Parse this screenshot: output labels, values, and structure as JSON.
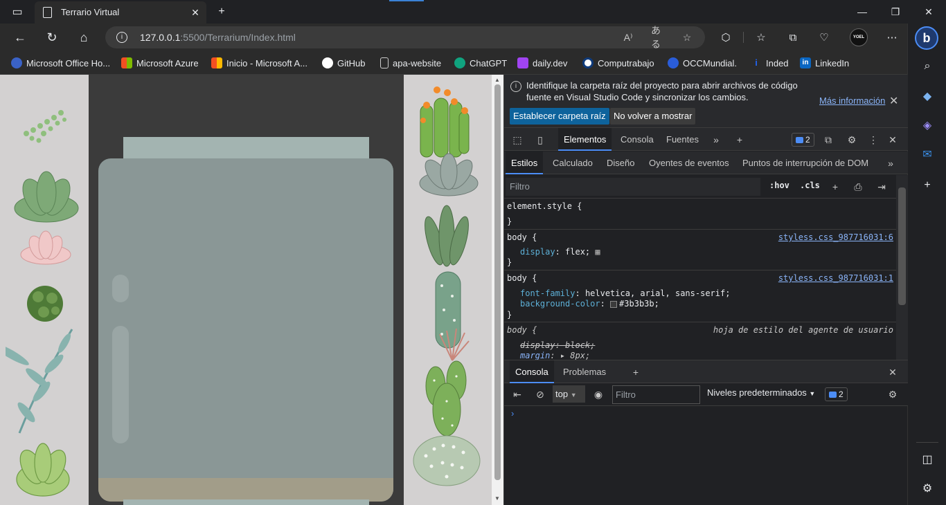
{
  "browser": {
    "tab_title": "Terrario Virtual",
    "url_host": "127.0.0.1",
    "url_path": ":5500/Terrarium/Index.html",
    "profile_label": "YOEL"
  },
  "bookmarks": [
    {
      "label": "Microsoft Office Ho...",
      "color": "#3a62c7"
    },
    {
      "label": "Microsoft Azure",
      "color": "#f25022"
    },
    {
      "label": "Inicio - Microsoft A...",
      "color": "#7fba00"
    },
    {
      "label": "GitHub",
      "color": "#ffffff"
    },
    {
      "label": "apa-website",
      "color": "#888888"
    },
    {
      "label": "ChatGPT",
      "color": "#10a37f"
    },
    {
      "label": "daily.dev",
      "color": "#a144f2"
    },
    {
      "label": "Computrabajo",
      "color": "#0e3a7a"
    },
    {
      "label": "OCCMundial.",
      "color": "#2a5dd9"
    },
    {
      "label": "Inded",
      "color": "#2164f3"
    },
    {
      "label": "LinkedIn",
      "color": "#0a66c2"
    }
  ],
  "devtools": {
    "infobar": {
      "message": "Identifique la carpeta raíz del proyecto para abrir archivos de código fuente en Visual Studio Code y sincronizar los cambios.",
      "more_link": "Más información",
      "primary_button": "Establecer carpeta raíz",
      "secondary_button": "No volver a mostrar"
    },
    "main_tabs": [
      "Elementos",
      "Consola",
      "Fuentes"
    ],
    "issues_count": "2",
    "style_tabs": [
      "Estilos",
      "Calculado",
      "Diseño",
      "Oyentes de eventos",
      "Puntos de interrupción de DOM"
    ],
    "filter_placeholder": "Filtro",
    "hov_label": ":hov",
    "cls_label": ".cls",
    "rules": {
      "element_style": "element.style {",
      "close": "}",
      "rule1_selector": "body {",
      "rule1_source": "styless.css_987716031:6",
      "rule1_prop": "display",
      "rule1_value": "flex;",
      "rule2_selector": "body {",
      "rule2_source": "styless.css_987716031:1",
      "rule2_prop1": "font-family",
      "rule2_value1": "helvetica, arial, sans-serif;",
      "rule2_prop2": "background-color",
      "rule2_value2": "#3b3b3b;",
      "rule3_selector": "body {",
      "rule3_source": "hoja de estilo del agente de usuario",
      "rule3_prop1": "display: block;",
      "rule3_prop2": "margin",
      "rule3_value2": "8px;"
    },
    "drawer_tabs": [
      "Consola",
      "Problemas"
    ],
    "console": {
      "context": "top",
      "filter_placeholder": "Filtro",
      "levels": "Niveles predeterminados",
      "issues_count": "2",
      "prompt": "›"
    }
  }
}
